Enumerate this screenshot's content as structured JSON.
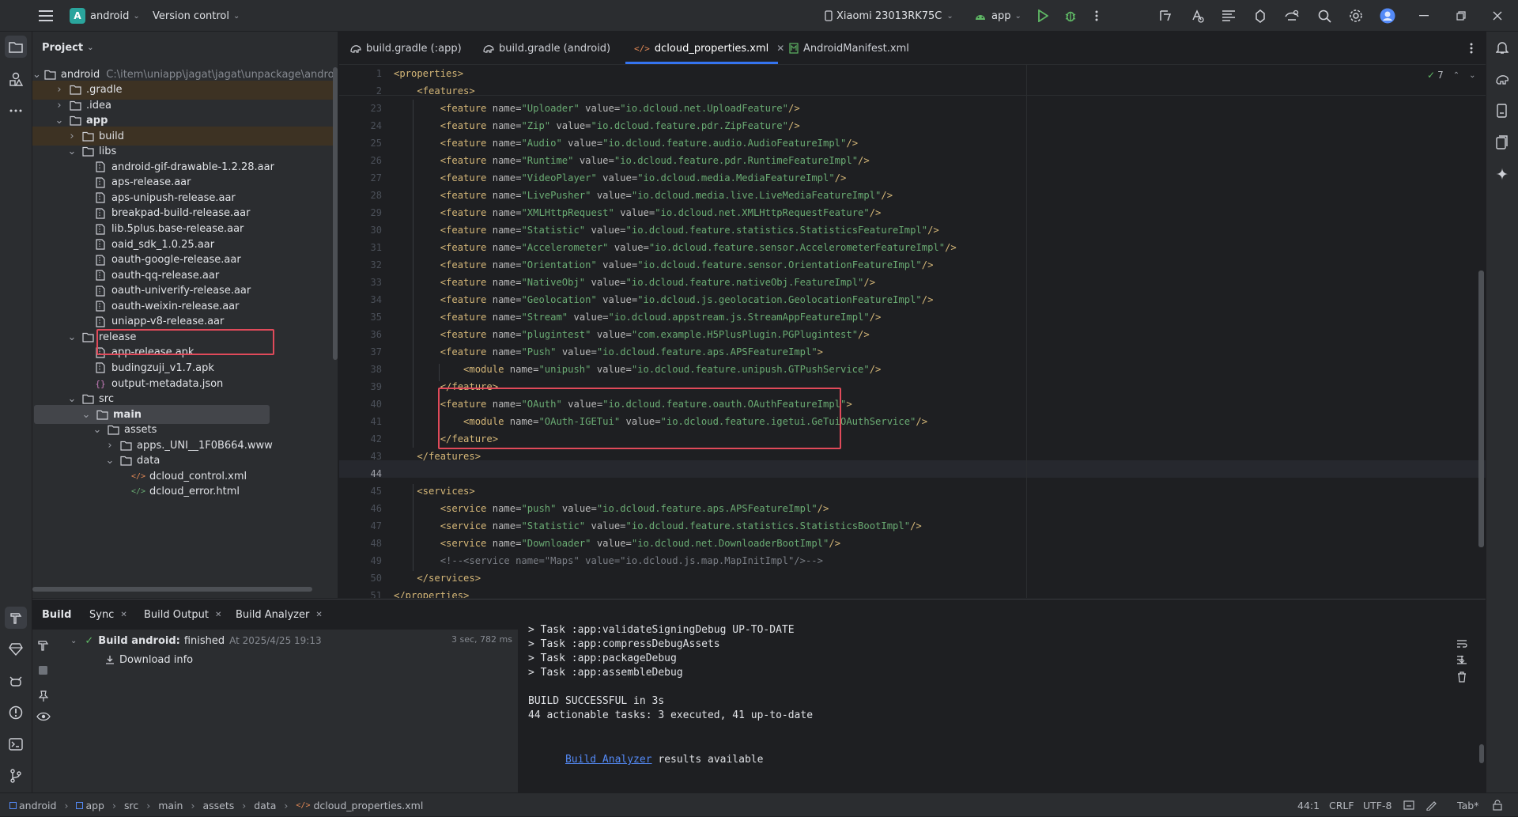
{
  "titlebar": {
    "project_badge": "A",
    "project_name": "android",
    "vcs": "Version control",
    "device": "Xiaomi 23013RK75C",
    "run_config": "app"
  },
  "project_panel": {
    "title": "Project",
    "tree": [
      {
        "label": "android",
        "path": "C:\\item\\uniapp\\jagat\\jagat\\unpackage\\android",
        "icon": "folder-icon"
      },
      {
        "label": ".gradle",
        "icon": "folder-icon"
      },
      {
        "label": ".idea",
        "icon": "folder-icon"
      },
      {
        "label": "app",
        "icon": "folder-icon"
      },
      {
        "label": "build",
        "icon": "folder-icon"
      },
      {
        "label": "libs",
        "icon": "folder-icon"
      },
      {
        "label": "android-gif-drawable-1.2.28.aar",
        "icon": "archive-icon"
      },
      {
        "label": "aps-release.aar",
        "icon": "archive-icon"
      },
      {
        "label": "aps-unipush-release.aar",
        "icon": "archive-icon"
      },
      {
        "label": "breakpad-build-release.aar",
        "icon": "archive-icon"
      },
      {
        "label": "lib.5plus.base-release.aar",
        "icon": "archive-icon"
      },
      {
        "label": "oaid_sdk_1.0.25.aar",
        "icon": "archive-icon"
      },
      {
        "label": "oauth-google-release.aar",
        "icon": "archive-icon"
      },
      {
        "label": "oauth-qq-release.aar",
        "icon": "archive-icon"
      },
      {
        "label": "oauth-univerify-release.aar",
        "icon": "archive-icon"
      },
      {
        "label": "oauth-weixin-release.aar",
        "icon": "archive-icon"
      },
      {
        "label": "uniapp-v8-release.aar",
        "icon": "archive-icon"
      },
      {
        "label": "release",
        "icon": "folder-icon"
      },
      {
        "label": "app-release.apk",
        "icon": "archive-icon"
      },
      {
        "label": "budingzuji_v1.7.apk",
        "icon": "archive-icon"
      },
      {
        "label": "output-metadata.json",
        "icon": "json-icon"
      },
      {
        "label": "src",
        "icon": "folder-icon"
      },
      {
        "label": "main",
        "icon": "folder-icon"
      },
      {
        "label": "assets",
        "icon": "folder-icon"
      },
      {
        "label": "apps._UNI__1F0B664.www",
        "icon": "folder-icon"
      },
      {
        "label": "data",
        "icon": "folder-icon"
      },
      {
        "label": "dcloud_control.xml",
        "icon": "xml-icon"
      },
      {
        "label": "dcloud_error.html",
        "icon": "html-icon"
      }
    ]
  },
  "tabs": [
    {
      "label": "build.gradle (:app)"
    },
    {
      "label": "build.gradle (android)"
    },
    {
      "label": "dcloud_properties.xml"
    },
    {
      "label": "AndroidManifest.xml"
    }
  ],
  "editor": {
    "inspection_count": "7",
    "line_numbers": [
      "1",
      "2",
      "23",
      "24",
      "25",
      "26",
      "27",
      "28",
      "29",
      "30",
      "31",
      "32",
      "33",
      "34",
      "35",
      "36",
      "37",
      "38",
      "39",
      "40",
      "41",
      "42",
      "43",
      "44",
      "45",
      "46",
      "47",
      "48",
      "49",
      "50",
      "51"
    ],
    "lines": [
      "<properties>",
      "    <features>",
      "        <feature name=\"Uploader\" value=\"io.dcloud.net.UploadFeature\"/>",
      "        <feature name=\"Zip\" value=\"io.dcloud.feature.pdr.ZipFeature\"/>",
      "        <feature name=\"Audio\" value=\"io.dcloud.feature.audio.AudioFeatureImpl\"/>",
      "        <feature name=\"Runtime\" value=\"io.dcloud.feature.pdr.RuntimeFeatureImpl\"/>",
      "        <feature name=\"VideoPlayer\" value=\"io.dcloud.media.MediaFeatureImpl\"/>",
      "        <feature name=\"LivePusher\" value=\"io.dcloud.media.live.LiveMediaFeatureImpl\"/>",
      "        <feature name=\"XMLHttpRequest\" value=\"io.dcloud.net.XMLHttpRequestFeature\"/>",
      "        <feature name=\"Statistic\" value=\"io.dcloud.feature.statistics.StatisticsFeatureImpl\"/>",
      "        <feature name=\"Accelerometer\" value=\"io.dcloud.feature.sensor.AccelerometerFeatureImpl\"/>",
      "        <feature name=\"Orientation\" value=\"io.dcloud.feature.sensor.OrientationFeatureImpl\"/>",
      "        <feature name=\"NativeObj\" value=\"io.dcloud.feature.nativeObj.FeatureImpl\"/>",
      "        <feature name=\"Geolocation\" value=\"io.dcloud.js.geolocation.GeolocationFeatureImpl\"/>",
      "        <feature name=\"Stream\" value=\"io.dcloud.appstream.js.StreamAppFeatureImpl\"/>",
      "        <feature name=\"plugintest\" value=\"com.example.H5PlusPlugin.PGPlugintest\"/>",
      "        <feature name=\"Push\" value=\"io.dcloud.feature.aps.APSFeatureImpl\">",
      "            <module name=\"unipush\" value=\"io.dcloud.feature.unipush.GTPushService\"/>",
      "        </feature>",
      "        <feature name=\"OAuth\" value=\"io.dcloud.feature.oauth.OAuthFeatureImpl\">",
      "            <module name=\"OAuth-IGETui\" value=\"io.dcloud.feature.igetui.GeTuiOAuthService\"/>",
      "        </feature>",
      "    </features>",
      "",
      "    <services>",
      "        <service name=\"push\" value=\"io.dcloud.feature.aps.APSFeatureImpl\"/>",
      "        <service name=\"Statistic\" value=\"io.dcloud.feature.statistics.StatisticsBootImpl\"/>",
      "        <service name=\"Downloader\" value=\"io.dcloud.net.DownloaderBootImpl\"/>",
      "        <!--<service name=\"Maps\" value=\"io.dcloud.js.map.MapInitImpl\"/>-->",
      "    </services>",
      "</properties>"
    ]
  },
  "build_panel": {
    "tabs": [
      {
        "label": "Build"
      },
      {
        "label": "Sync"
      },
      {
        "label": "Build Output"
      },
      {
        "label": "Build Analyzer"
      }
    ],
    "tree": {
      "title": "Build android:",
      "status": "finished",
      "timestamp": "At 2025/4/25 19:13",
      "duration": "3 sec, 782 ms",
      "child": "Download info"
    },
    "output": [
      "> Task :app:validateSigningDebug UP-TO-DATE",
      "> Task :app:compressDebugAssets",
      "> Task :app:packageDebug",
      "> Task :app:assembleDebug",
      "",
      "BUILD SUCCESSFUL in 3s",
      "44 actionable tasks: 3 executed, 41 up-to-date",
      ""
    ],
    "link_text": "Build Analyzer",
    "link_suffix": " results available"
  },
  "statusbar": {
    "breadcrumbs": [
      "android",
      "app",
      "src",
      "main",
      "assets",
      "data",
      "dcloud_properties.xml"
    ],
    "position": "44:1",
    "line_sep": "CRLF",
    "encoding": "UTF-8",
    "indent": "Tab*"
  },
  "colors": {
    "accent": "#3574f0",
    "highlight_box": "#e04a5a",
    "tag": "#d5b778",
    "attr_value": "#6aab73",
    "run_green": "#5fb865"
  }
}
